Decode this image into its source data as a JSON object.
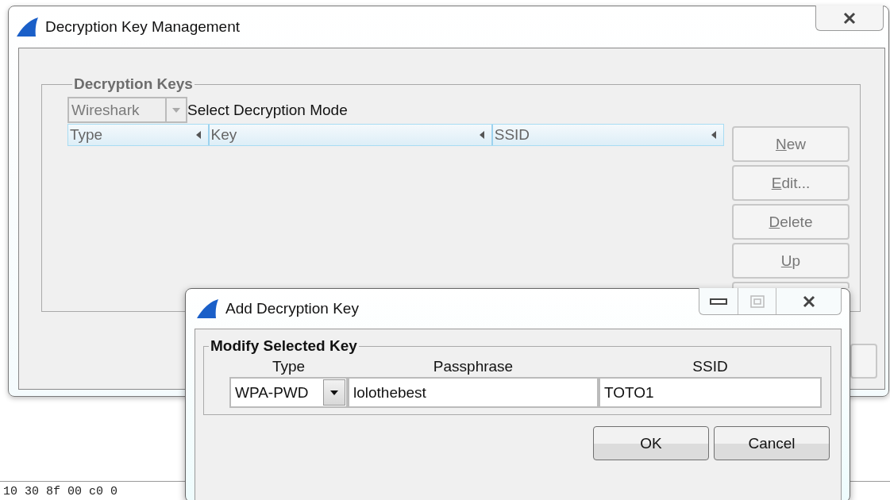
{
  "background": {
    "hex_line": "10 30 8f 00 c0 0"
  },
  "main_window": {
    "title": "Decryption Key Management",
    "group_title": "Decryption Keys",
    "mode_combo": {
      "value": "Wireshark",
      "disabled": true
    },
    "mode_label": "Select Decryption Mode",
    "table": {
      "columns": [
        "Type",
        "Key",
        "SSID"
      ]
    },
    "buttons": [
      {
        "label": "New",
        "underline_first": true
      },
      {
        "label": "Edit...",
        "underline_first": true
      },
      {
        "label": "Delete",
        "underline_first": true
      },
      {
        "label": "Up",
        "underline_first": true
      }
    ]
  },
  "dialog": {
    "title": "Add Decryption Key",
    "group_title": "Modify Selected Key",
    "fields": [
      {
        "label": "Type",
        "kind": "combo",
        "value": "WPA-PWD"
      },
      {
        "label": "Passphrase",
        "kind": "text",
        "value": "lolothebest"
      },
      {
        "label": "SSID",
        "kind": "text",
        "value": "TOTO1"
      }
    ],
    "buttons": [
      "OK",
      "Cancel"
    ]
  }
}
